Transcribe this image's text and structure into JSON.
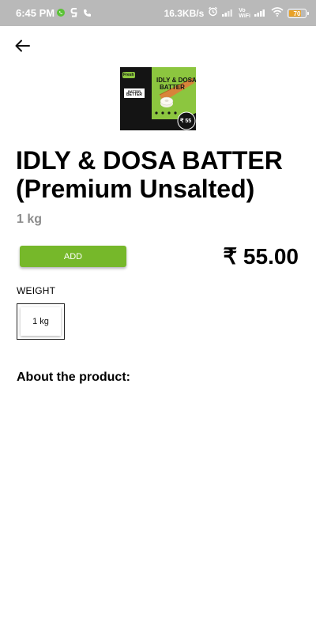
{
  "status_bar": {
    "time": "6:45 PM",
    "net_speed": "16.3KB/s",
    "volte_top": "Vo",
    "volte_bottom": "WiFi",
    "battery": "70",
    "battery_level": 0.7,
    "icons": [
      "whatsapp-icon",
      "g-icon",
      "phone-icon",
      "alarm-icon",
      "signal-icon",
      "wifi-icon",
      "battery-icon"
    ]
  },
  "header": {
    "back_icon": "arrow-left-icon"
  },
  "product": {
    "image": {
      "brand": "Fresh",
      "badge_line1": "BATTER",
      "badge_line2": "BETTER",
      "name_line1": "IDLY & DOSA",
      "name_line2": "BATTER",
      "price_badge": "₹ 55"
    },
    "title": "IDLY & DOSA BATTER (Premium Unsalted)",
    "quantity": "1 kg",
    "add_label": "ADD",
    "price": "₹ 55.00",
    "colors": {
      "accent": "#76b82a",
      "package_bg": "#121212",
      "package_green": "#8cc63f",
      "dosa": "#d8843a"
    }
  },
  "weight": {
    "label": "WEIGHT",
    "options": [
      "1 kg"
    ],
    "selected": "1 kg"
  },
  "about": {
    "heading": "About the product:"
  }
}
